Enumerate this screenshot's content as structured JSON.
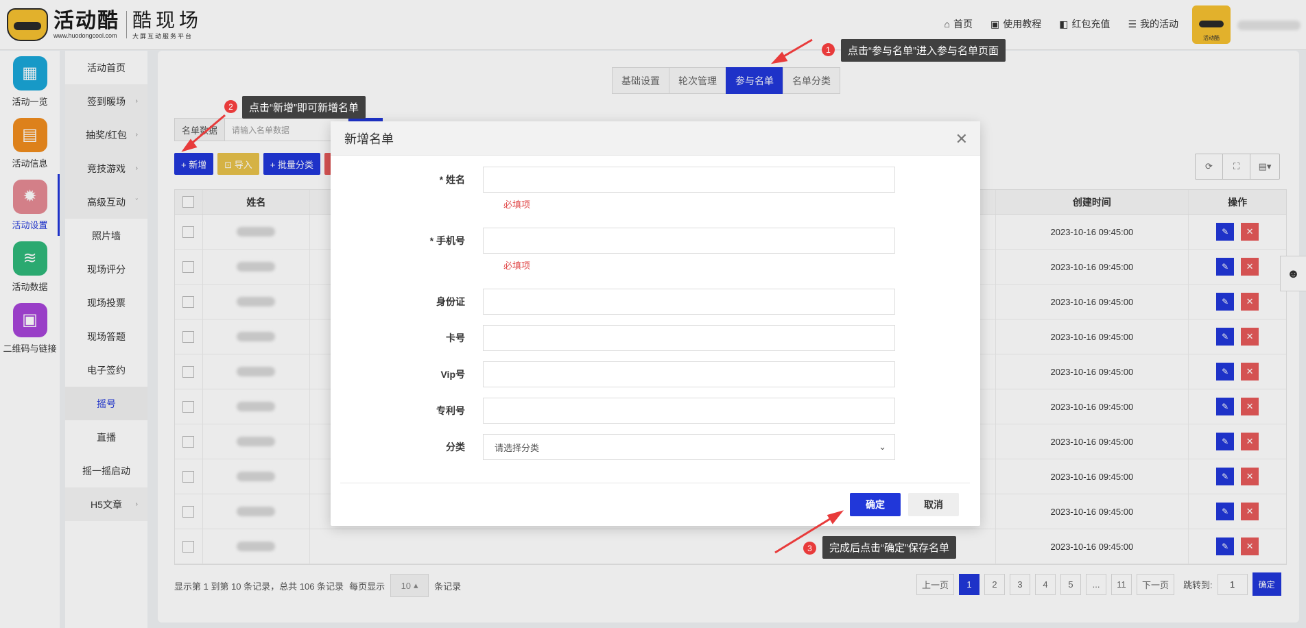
{
  "header": {
    "logo_title": "活动酷",
    "logo_url": "www.huodongcool.com",
    "logo_sub_title": "酷现场",
    "logo_sub_desc": "大屏互动服务平台",
    "nav": [
      {
        "icon": "home-icon",
        "label": "首页"
      },
      {
        "icon": "book-icon",
        "label": "使用教程"
      },
      {
        "icon": "wallet-icon",
        "label": "红包充值"
      },
      {
        "icon": "list-icon",
        "label": "我的活动"
      }
    ],
    "avatar_caption": "活动酷"
  },
  "sidebar_primary": [
    {
      "icon": "grid-icon",
      "label": "活动一览",
      "color": "#1aa7d8",
      "glyph": "▦"
    },
    {
      "icon": "document-icon",
      "label": "活动信息",
      "color": "#f08c1e",
      "glyph": "▤"
    },
    {
      "icon": "gear-icon",
      "label": "活动设置",
      "color": "#e58a94",
      "glyph": "✹",
      "active": true
    },
    {
      "icon": "database-icon",
      "label": "活动数据",
      "color": "#2fb87a",
      "glyph": "≋"
    },
    {
      "icon": "qrcode-icon",
      "label": "二维码与链接",
      "color": "#a744d8",
      "glyph": "▣"
    }
  ],
  "sidebar_secondary": [
    {
      "label": "活动首页",
      "arrow": "",
      "style": "sub"
    },
    {
      "label": "签到暖场",
      "arrow": "›",
      "style": "grey"
    },
    {
      "label": "抽奖/红包",
      "arrow": "›",
      "style": "grey"
    },
    {
      "label": "竞技游戏",
      "arrow": "›",
      "style": "grey"
    },
    {
      "label": "高级互动",
      "arrow": "ˇ",
      "style": "grey"
    },
    {
      "label": "照片墙",
      "arrow": "",
      "style": "sub"
    },
    {
      "label": "现场评分",
      "arrow": "",
      "style": "sub"
    },
    {
      "label": "现场投票",
      "arrow": "",
      "style": "sub"
    },
    {
      "label": "现场答题",
      "arrow": "",
      "style": "sub"
    },
    {
      "label": "电子签约",
      "arrow": "",
      "style": "sub"
    },
    {
      "label": "摇号",
      "arrow": "",
      "style": "active"
    },
    {
      "label": "直播",
      "arrow": "",
      "style": "sub"
    },
    {
      "label": "摇一摇启动",
      "arrow": "",
      "style": "sub"
    },
    {
      "label": "H5文章",
      "arrow": "›",
      "style": "grey"
    }
  ],
  "tabs": [
    {
      "label": "基础设置"
    },
    {
      "label": "轮次管理"
    },
    {
      "label": "参与名单",
      "active": true
    },
    {
      "label": "名单分类"
    }
  ],
  "search": {
    "label": "名单数据",
    "placeholder": "请输入名单数据"
  },
  "toolbar": {
    "add_label": "+ 新增",
    "import_label": "⊡ 导入",
    "batch_label": "+ 批量分类"
  },
  "table": {
    "headers": {
      "name": "姓名",
      "created": "创建时间",
      "ops": "操作"
    },
    "rows": [
      {
        "created": "2023-10-16 09:45:00"
      },
      {
        "created": "2023-10-16 09:45:00"
      },
      {
        "created": "2023-10-16 09:45:00"
      },
      {
        "created": "2023-10-16 09:45:00"
      },
      {
        "created": "2023-10-16 09:45:00"
      },
      {
        "created": "2023-10-16 09:45:00"
      },
      {
        "created": "2023-10-16 09:45:00"
      },
      {
        "created": "2023-10-16 09:45:00"
      },
      {
        "created": "2023-10-16 09:45:00"
      },
      {
        "created": "2023-10-16 09:45:00"
      }
    ]
  },
  "footer": {
    "info": "显示第 1 到第 10 条记录，总共 106 条记录",
    "per_page_label": "每页显示",
    "per_page_value": "10",
    "per_page_suffix": "条记录",
    "prev": "上一页",
    "pages": [
      "1",
      "2",
      "3",
      "4",
      "5",
      "...",
      "11"
    ],
    "current_page": "1",
    "next": "下一页",
    "jump_label": "跳转到:",
    "jump_value": "1",
    "jump_btn": "确定"
  },
  "modal": {
    "title": "新增名单",
    "fields": [
      {
        "label": "* 姓名",
        "error": "必填项"
      },
      {
        "label": "* 手机号",
        "error": "必填项"
      },
      {
        "label": "身份证"
      },
      {
        "label": "卡号"
      },
      {
        "label": "Vip号"
      },
      {
        "label": "专利号"
      }
    ],
    "category_label": "分类",
    "category_value": "请选择分类",
    "ok_label": "确定",
    "cancel_label": "取消"
  },
  "callouts": [
    {
      "step": "1",
      "text": "点击“参与名单”进入参与名单页面"
    },
    {
      "step": "2",
      "text": "点击“新增”即可新增名单"
    },
    {
      "step": "3",
      "text": "完成后点击“确定”保存名单"
    }
  ],
  "colors": {
    "primary": "#2137d9",
    "danger": "#e65a5a",
    "warning": "#e8c24a",
    "callout_bg": "#404040",
    "step_red": "#e83b3b"
  }
}
